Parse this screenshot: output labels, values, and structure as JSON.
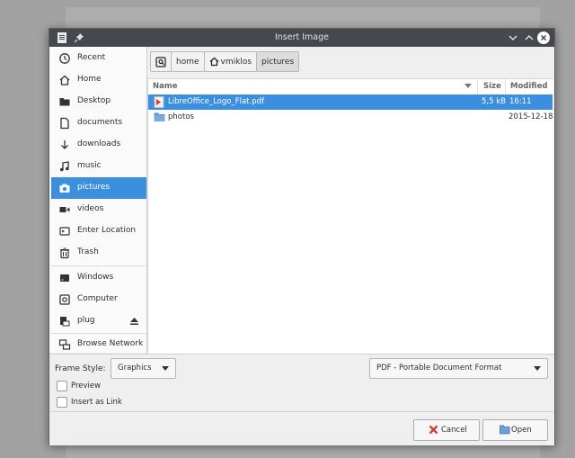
{
  "dialog": {
    "title": "Insert Image"
  },
  "sidebar": {
    "items": [
      {
        "label": "Recent",
        "icon": "clock-icon"
      },
      {
        "label": "Home",
        "icon": "home-icon"
      },
      {
        "label": "Desktop",
        "icon": "folder-icon"
      },
      {
        "label": "documents",
        "icon": "document-icon"
      },
      {
        "label": "downloads",
        "icon": "download-icon"
      },
      {
        "label": "music",
        "icon": "music-icon"
      },
      {
        "label": "pictures",
        "icon": "camera-icon",
        "active": true
      },
      {
        "label": "videos",
        "icon": "video-icon"
      },
      {
        "label": "Enter Location",
        "icon": "location-icon"
      },
      {
        "label": "Trash",
        "icon": "trash-icon"
      },
      {
        "label": "Windows",
        "icon": "drive-icon"
      },
      {
        "label": "Computer",
        "icon": "computer-icon"
      },
      {
        "label": "plug",
        "icon": "usb-drive-icon"
      },
      {
        "label": "Browse Network",
        "icon": "network-icon"
      }
    ]
  },
  "pathbar": {
    "crumbs": [
      "home",
      "vmiklos",
      "pictures"
    ]
  },
  "filelist": {
    "columns": {
      "name": "Name",
      "size": "Size",
      "modified": "Modified"
    },
    "rows": [
      {
        "name": "LibreOffice_Logo_Flat.pdf",
        "size": "5,5 kB",
        "modified": "16:11",
        "icon": "pdf-file-icon",
        "selected": true
      },
      {
        "name": "photos",
        "size": "",
        "modified": "2015-12-18",
        "icon": "folder-icon",
        "selected": false
      }
    ]
  },
  "options": {
    "frame_style_label": "Frame Style:",
    "frame_style_value": "Graphics",
    "filter_value": "PDF - Portable Document Format",
    "preview_label": "Preview",
    "link_label": "Insert as Link"
  },
  "buttons": {
    "cancel": "Cancel",
    "open": "Open"
  },
  "colors": {
    "accent": "#3c8fde",
    "titlebar": "#45494e"
  }
}
